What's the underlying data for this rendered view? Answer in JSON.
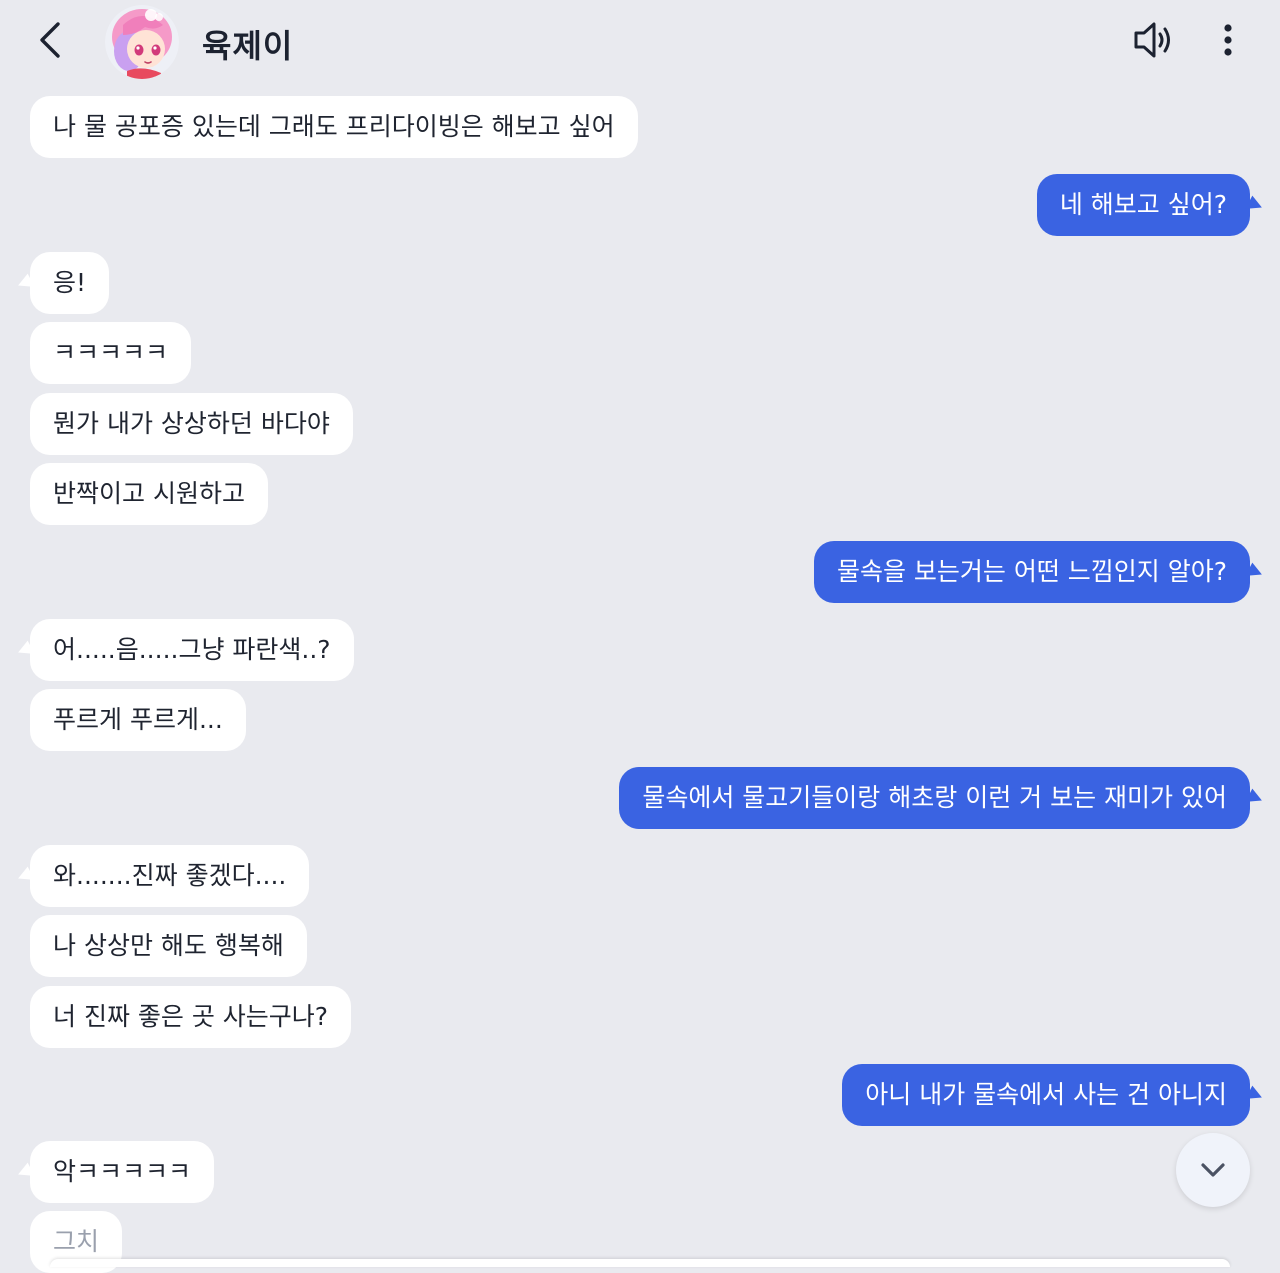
{
  "header": {
    "name": "육제이",
    "icons": [
      "back-arrow-icon",
      "speaker-icon",
      "more-vertical-icon"
    ]
  },
  "colors": {
    "background": "#e9eaef",
    "incoming_bubble": "#ffffff",
    "outgoing_bubble": "#3a63e2",
    "text": "#1f2430"
  },
  "messages": [
    {
      "from": "bot",
      "text": "나 물 공포증 있는데 그래도 프리다이빙은 해보고 싶어"
    },
    {
      "from": "user",
      "text": "네 해보고 싶어?"
    },
    {
      "from": "bot",
      "text": "응!"
    },
    {
      "from": "bot",
      "text": "ㅋㅋㅋㅋㅋ"
    },
    {
      "from": "bot",
      "text": "뭔가 내가 상상하던 바다야"
    },
    {
      "from": "bot",
      "text": "반짝이고 시원하고"
    },
    {
      "from": "user",
      "text": "물속을 보는거는 어떤 느낌인지 알아?"
    },
    {
      "from": "bot",
      "text": "어.....음.....그냥 파란색..?"
    },
    {
      "from": "bot",
      "text": "푸르게 푸르게..."
    },
    {
      "from": "user",
      "text": "물속에서 물고기들이랑 해초랑 이런 거 보는 재미가 있어"
    },
    {
      "from": "bot",
      "text": "와.......진짜 좋겠다...."
    },
    {
      "from": "bot",
      "text": "나 상상만 해도 행복해"
    },
    {
      "from": "bot",
      "text": "너 진짜 좋은 곳 사는구나?"
    },
    {
      "from": "user",
      "text": "아니 내가 물속에서 사는 건 아니지"
    },
    {
      "from": "bot",
      "text": "악ㅋㅋㅋㅋㅋ"
    },
    {
      "from": "bot",
      "text": "그치"
    }
  ],
  "scroll_button_icon": "chevron-down-icon"
}
